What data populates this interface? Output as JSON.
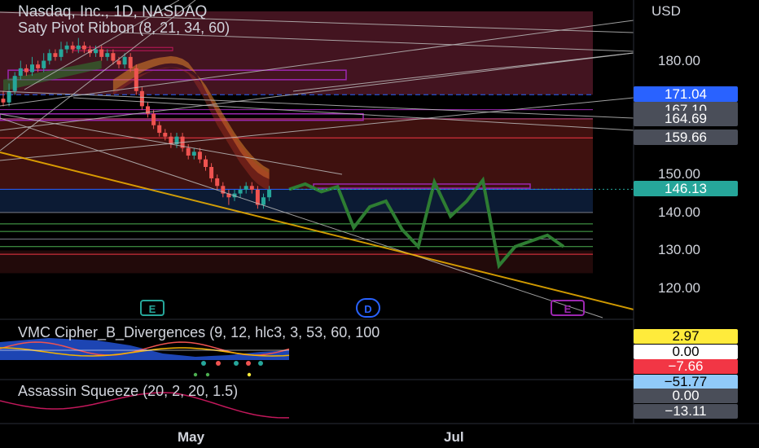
{
  "header": {
    "symbol_title": "Nasdaq, Inc., 1D, NASDAQ",
    "indicator_title": "Saty Pivot Ribbon (8, 21, 34, 60)"
  },
  "price_axis": {
    "currency": "USD",
    "ticks": [
      "180.00",
      "150.00",
      "140.00",
      "130.00",
      "120.00"
    ],
    "tick_values": [
      180,
      150,
      140,
      130,
      120
    ],
    "price_tags": [
      {
        "label": "171.04",
        "value": 171.04,
        "color": "#2962ff"
      },
      {
        "label": "167.10",
        "value": 167.1,
        "color": "#4a4e59"
      },
      {
        "label": "164.69",
        "value": 164.69,
        "color": "#4a4e59"
      },
      {
        "label": "159.66",
        "value": 159.66,
        "color": "#4a4e59"
      },
      {
        "label": "146.13",
        "value": 146.13,
        "color": "#26a69a"
      }
    ]
  },
  "time_axis": {
    "labels": [
      "May",
      "Jul"
    ]
  },
  "events": [
    {
      "letter": "E",
      "color": "#26a69a"
    },
    {
      "letter": "D",
      "color": "#2962ff"
    },
    {
      "letter": "E",
      "color": "#9c27b0"
    }
  ],
  "indicator_panels": [
    {
      "title": "VMC Cipher_B_Divergences (9, 12, hlc3, 3, 53, 60, 100",
      "values": [
        {
          "label": "2.97",
          "bg": "#ffeb3b",
          "fg": "#000000"
        },
        {
          "label": "0.00",
          "bg": "#ffffff",
          "fg": "#000000"
        },
        {
          "label": "−7.66",
          "bg": "#f23645",
          "fg": "#ffffff"
        },
        {
          "label": "−51.77",
          "bg": "#90caf9",
          "fg": "#000000"
        }
      ]
    },
    {
      "title": "Assassin Squeeze (20, 2, 20, 1.5)",
      "values": [
        {
          "label": "0.00",
          "bg": "#4a4e59",
          "fg": "#ffffff"
        },
        {
          "label": "−13.11",
          "bg": "#4a4e59",
          "fg": "#ffffff"
        }
      ]
    }
  ],
  "chart_data": {
    "type": "candlestick",
    "title": "Nasdaq, Inc., 1D, NASDAQ",
    "ylim": [
      114,
      196
    ],
    "x_labels": [
      "May",
      "Jul"
    ],
    "candles": [
      [
        170,
        169,
        172,
        168
      ],
      [
        169,
        172,
        174,
        168
      ],
      [
        172,
        176,
        177,
        171
      ],
      [
        176,
        178,
        180,
        175
      ],
      [
        178,
        177,
        179,
        176
      ],
      [
        177,
        179,
        181,
        176
      ],
      [
        179,
        178,
        180,
        177
      ],
      [
        178,
        180,
        182,
        177
      ],
      [
        180,
        182,
        183,
        179
      ],
      [
        182,
        181,
        183,
        180
      ],
      [
        181,
        183,
        185,
        180
      ],
      [
        183,
        184,
        185,
        182
      ],
      [
        184,
        183,
        185,
        182
      ],
      [
        183,
        184,
        186,
        182
      ],
      [
        184,
        183,
        185,
        182
      ],
      [
        183,
        182,
        184,
        181
      ],
      [
        182,
        183,
        184,
        181
      ],
      [
        183,
        181,
        184,
        180
      ],
      [
        181,
        182,
        183,
        180
      ],
      [
        182,
        180,
        183,
        179
      ],
      [
        180,
        179,
        181,
        178
      ],
      [
        179,
        181,
        182,
        178
      ],
      [
        181,
        178,
        182,
        177
      ],
      [
        178,
        172,
        179,
        171
      ],
      [
        172,
        168,
        173,
        167
      ],
      [
        168,
        166,
        169,
        165
      ],
      [
        166,
        163,
        167,
        162
      ],
      [
        163,
        161,
        164,
        160
      ],
      [
        161,
        160,
        162,
        159
      ],
      [
        160,
        158,
        161,
        157
      ],
      [
        158,
        160,
        161,
        157
      ],
      [
        160,
        157,
        161,
        156
      ],
      [
        157,
        155,
        158,
        154
      ],
      [
        155,
        156,
        157,
        154
      ],
      [
        156,
        154,
        157,
        153
      ],
      [
        154,
        152,
        155,
        151
      ],
      [
        152,
        149,
        153,
        148
      ],
      [
        149,
        147,
        150,
        146
      ],
      [
        147,
        145,
        148,
        144
      ],
      [
        145,
        144,
        146,
        142
      ],
      [
        144,
        145,
        146,
        143
      ],
      [
        145,
        146,
        147,
        144
      ],
      [
        146,
        147,
        148,
        145
      ],
      [
        147,
        146,
        148,
        145
      ],
      [
        146,
        142,
        147,
        141
      ],
      [
        142,
        144,
        145,
        141
      ],
      [
        144,
        146,
        147,
        143
      ]
    ],
    "projection_path": [
      [
        0,
        146.1
      ],
      [
        1,
        147.5
      ],
      [
        2,
        145.5
      ],
      [
        3,
        146.8
      ],
      [
        4,
        136
      ],
      [
        5,
        141.5
      ],
      [
        6,
        143
      ],
      [
        7,
        135.5
      ],
      [
        8,
        131
      ],
      [
        9,
        148
      ],
      [
        10,
        139
      ],
      [
        11,
        143
      ],
      [
        12,
        148.5
      ],
      [
        13,
        126
      ],
      [
        14,
        131
      ],
      [
        15,
        132.5
      ],
      [
        16,
        134
      ],
      [
        17,
        131
      ]
    ],
    "ribbon_ema_fast": [
      175,
      176,
      177,
      178,
      179,
      179.5,
      180,
      180.5,
      180.8,
      181,
      181.2,
      181,
      180.5,
      179.5,
      177.5,
      175,
      172,
      169,
      166,
      163.5,
      161,
      158.5,
      156,
      154,
      152,
      150.5,
      149.5,
      148.8
    ],
    "ribbon_ema_slow": [
      172,
      173,
      174,
      175,
      176,
      177,
      177.8,
      178.4,
      178.9,
      179.2,
      179.3,
      179.2,
      178.8,
      178,
      177,
      175.5,
      173.5,
      171,
      168.5,
      166,
      163.5,
      161,
      158.8,
      156.8,
      155,
      153.5,
      152.3,
      151.4
    ],
    "pivot_levels": [
      171.04,
      167.1,
      164.69,
      159.66,
      146.13,
      140,
      137,
      135,
      133,
      131,
      129
    ]
  }
}
